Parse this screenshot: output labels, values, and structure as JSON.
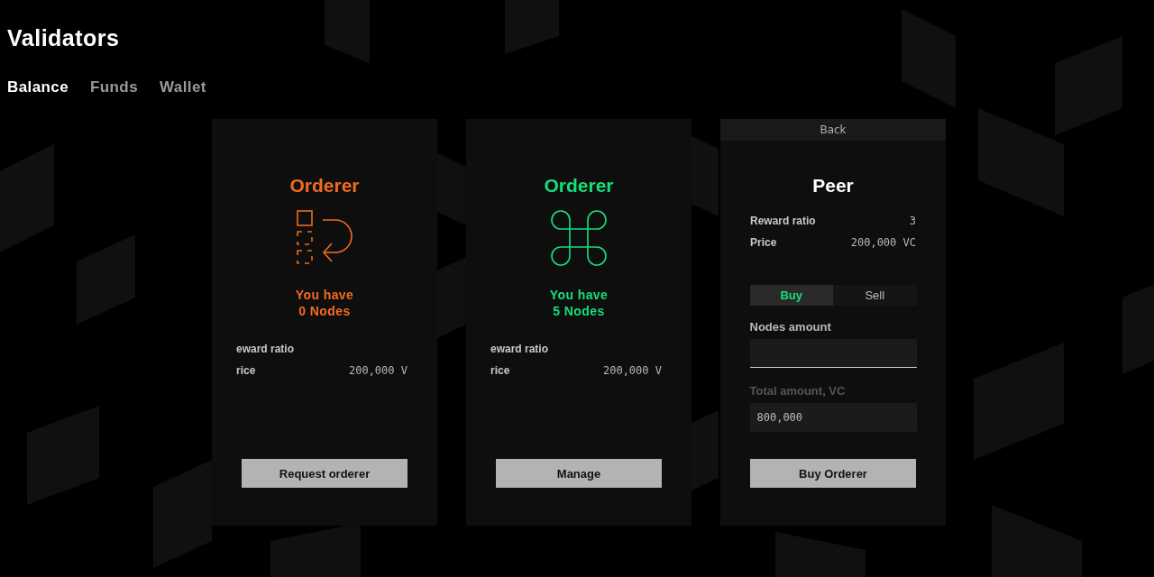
{
  "page": {
    "title": "Validators"
  },
  "tabs": [
    {
      "label": "Balance",
      "selected": true
    },
    {
      "label": "Funds",
      "selected": false
    },
    {
      "label": "Wallet",
      "selected": false
    }
  ],
  "cards": [
    {
      "kind": "summary",
      "title": "Orderer",
      "color": "#f26b1d",
      "have_line": "You have",
      "nodes_line": "0 Nodes",
      "rows": [
        {
          "label": "eward ratio"
        },
        {
          "label": "rice",
          "value": "200,000 V"
        }
      ],
      "button": "Request orderer"
    },
    {
      "kind": "summary",
      "title": "Orderer",
      "color": "#14e07a",
      "have_line": "You have",
      "nodes_line": "5 Nodes",
      "rows": [
        {
          "label": "eward ratio"
        },
        {
          "label": "rice",
          "value": "200,000 V"
        }
      ],
      "button": "Manage"
    },
    {
      "kind": "form",
      "back": "Back",
      "title": "Peer",
      "rows": [
        {
          "label": "Reward ratio",
          "value": "3"
        },
        {
          "label": "Price",
          "value": "200,000 VC"
        }
      ],
      "modes": [
        {
          "label": "Buy",
          "selected": true
        },
        {
          "label": "Sell",
          "selected": false
        }
      ],
      "amount_label": "Nodes amount",
      "total_label": "Total amount, VC",
      "total_disabled": true,
      "total_value": "800,000",
      "button": "Buy Orderer"
    }
  ]
}
